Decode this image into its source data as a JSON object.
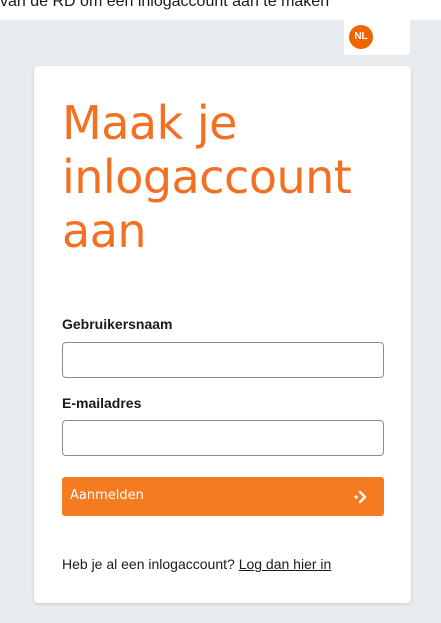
{
  "top_banner": {
    "text": "van de RD om een inlogaccount aan te maken"
  },
  "language": {
    "code": "NL"
  },
  "form": {
    "title": "Maak je inlogaccount aan",
    "username_label": "Gebruikersnaam",
    "username_value": "",
    "email_label": "E-mailadres",
    "email_value": "",
    "submit_label": "Aanmelden",
    "login_prompt": "Heb je al een inlogaccount?",
    "login_link": "Log dan hier in"
  },
  "colors": {
    "accent": "#f37022",
    "button": "#f47b20",
    "background": "#e8ebee"
  },
  "icons": {
    "submit": "arrow-right-icon"
  }
}
